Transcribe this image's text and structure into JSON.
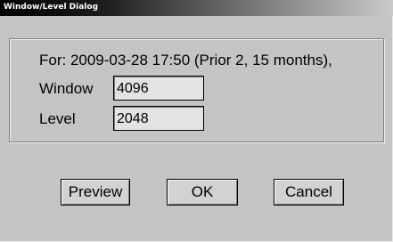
{
  "window": {
    "title": "Window/Level Dialog"
  },
  "info": {
    "text": "For: 2009-03-28 17:50 (Prior 2, 15 months),"
  },
  "fields": {
    "window": {
      "label": "Window",
      "value": "4096"
    },
    "level": {
      "label": "Level",
      "value": "2048"
    }
  },
  "buttons": {
    "preview": "Preview",
    "ok": "OK",
    "cancel": "Cancel"
  }
}
